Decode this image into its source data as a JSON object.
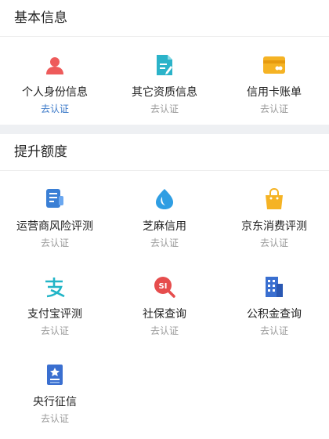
{
  "basic": {
    "title": "基本信息",
    "items": [
      {
        "label": "个人身份信息",
        "status": "去认证"
      },
      {
        "label": "其它资质信息",
        "status": "去认证"
      },
      {
        "label": "信用卡账单",
        "status": "去认证"
      }
    ]
  },
  "boost": {
    "title": "提升额度",
    "items": [
      {
        "label": "运营商风险评测",
        "status": "去认证"
      },
      {
        "label": "芝麻信用",
        "status": "去认证"
      },
      {
        "label": "京东消费评测",
        "status": "去认证"
      },
      {
        "label": "支付宝评测",
        "status": "去认证"
      },
      {
        "label": "社保查询",
        "status": "去认证"
      },
      {
        "label": "公积金查询",
        "status": "去认证"
      },
      {
        "label": "央行征信",
        "status": "去认证"
      }
    ]
  },
  "icons": {
    "person": "person-icon",
    "document": "document-edit-icon",
    "card": "credit-card-icon",
    "phone": "phone-report-icon",
    "sesame": "sesame-drop-icon",
    "jd": "shopping-bag-icon",
    "alipay": "alipay-icon",
    "social": "social-security-search-icon",
    "fund": "building-icon",
    "central": "credit-report-icon"
  },
  "colors": {
    "status_active": "#3a78c8",
    "status_default": "#9a9a9a"
  }
}
